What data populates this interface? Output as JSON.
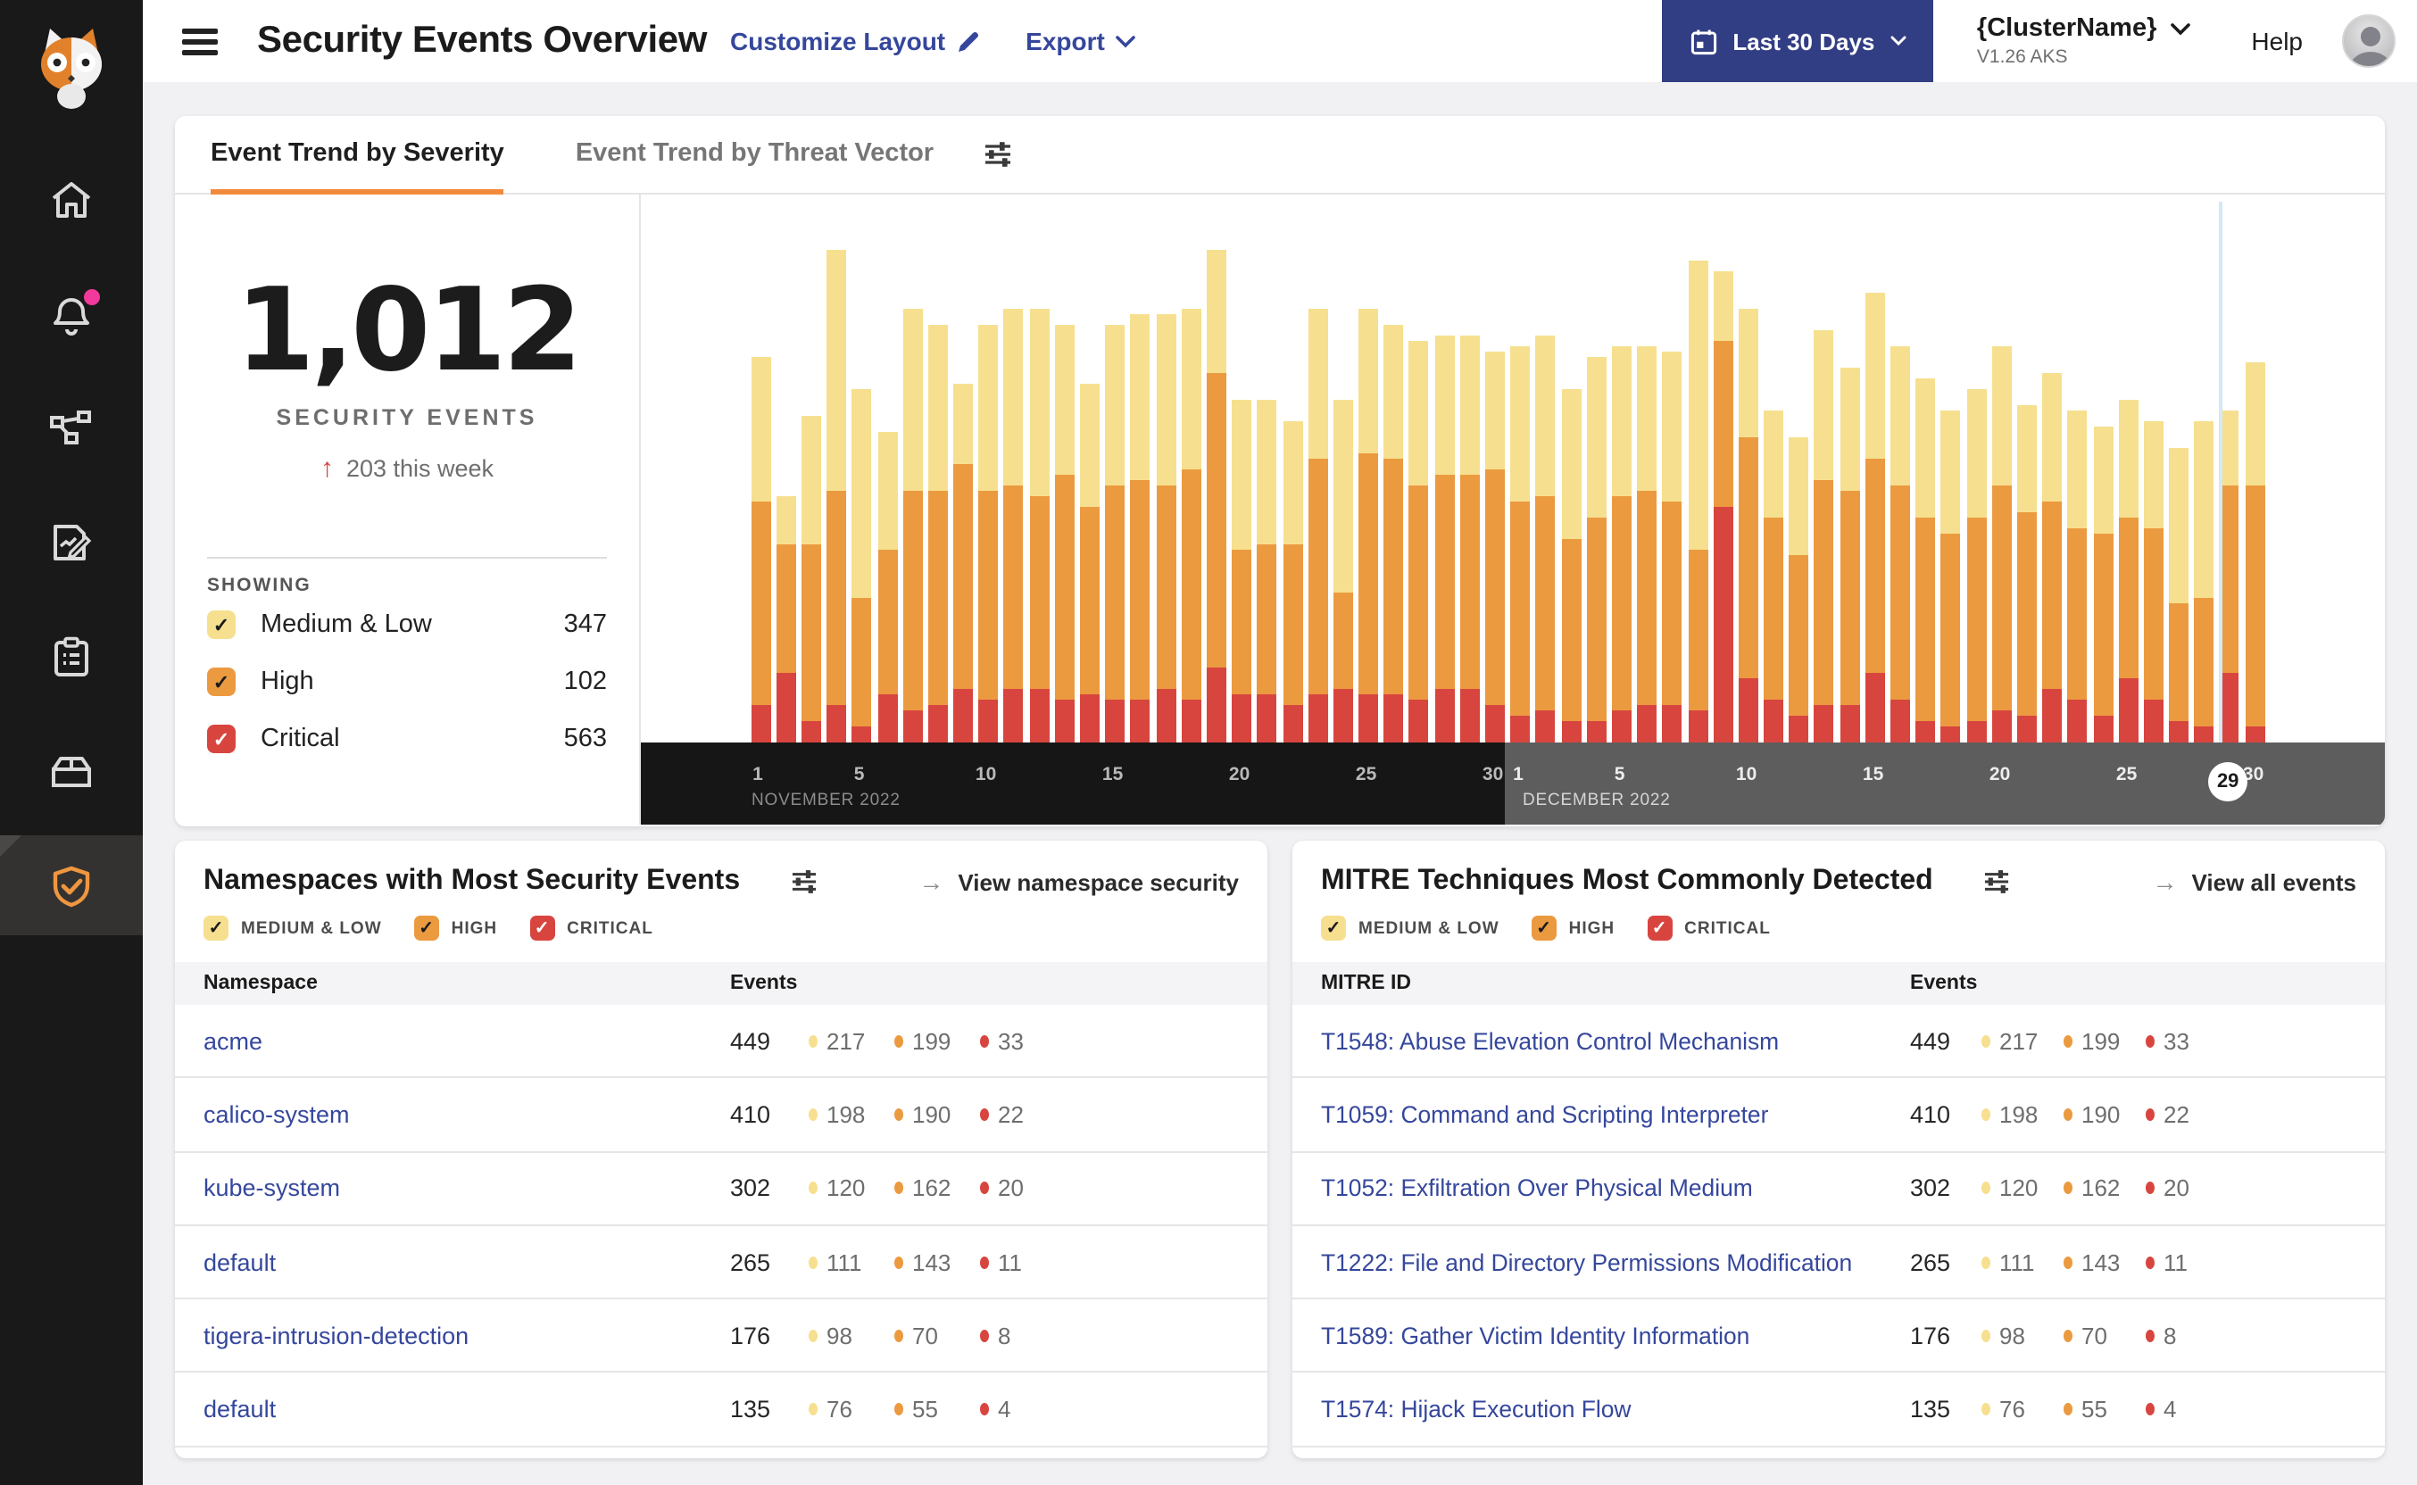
{
  "glyphs": {
    "check": "✓",
    "arrow_right": "→",
    "delta_up": "↑"
  },
  "colors": {
    "medium_low": "#f6e08f",
    "high": "#eb9a40",
    "critical": "#d8453f",
    "link_blue": "#35479c",
    "accent_orange": "#f18a3b",
    "navy": "#323e83",
    "notification_pink": "#f0399b",
    "axis_nov_bg": "#161616",
    "axis_dec_bg": "#5d5d5d",
    "today_line": "#d3e9f4",
    "check_dark": "#1b1b1b",
    "check_white": "#ffffff"
  },
  "sidebar": {
    "items": [
      {
        "icon": "home-icon"
      },
      {
        "icon": "alerts-bell-icon",
        "badge": true
      },
      {
        "icon": "network-graph-icon"
      },
      {
        "icon": "report-edit-icon"
      },
      {
        "icon": "clipboard-icon"
      },
      {
        "icon": "package-icon"
      },
      {
        "icon": "shield-check-icon",
        "active": true
      }
    ]
  },
  "header": {
    "title": "Security Events Overview",
    "customize_label": "Customize Layout",
    "export_label": "Export",
    "date_range_label": "Last 30 Days",
    "cluster_name": "{ClusterName}",
    "cluster_version": "V1.26 AKS",
    "help_label": "Help"
  },
  "trend_card": {
    "tabs": [
      {
        "label": "Event Trend by Severity",
        "active": true
      },
      {
        "label": "Event Trend by Threat Vector",
        "active": false
      }
    ],
    "stats": {
      "total": "1,012",
      "label": "SECURITY EVENTS",
      "delta_text": "203 this week"
    },
    "showing_label": "SHOWING",
    "severities": [
      {
        "label": "Medium & Low",
        "count": "347",
        "color": "#f6e08f",
        "check": "#1b1b1b"
      },
      {
        "label": "High",
        "count": "102",
        "color": "#eb9a40",
        "check": "#1b1b1b"
      },
      {
        "label": "Critical",
        "count": "563",
        "color": "#d8453f",
        "check": "#ffffff"
      }
    ]
  },
  "chart_data": {
    "type": "bar",
    "stacked": true,
    "legend_position": "left-panel",
    "grid": false,
    "unit": "relative bar-segment height, % of plot height (no y-axis shown)",
    "series_colors": {
      "critical": "#d8453f",
      "high": "#eb9a40",
      "medium_low": "#f6e08f"
    },
    "months": [
      {
        "label": "NOVEMBER 2022",
        "ticks": [
          1,
          5,
          10,
          15,
          20,
          25,
          30
        ]
      },
      {
        "label": "DECEMBER 2022",
        "ticks": [
          1,
          5,
          10,
          15,
          20,
          25,
          30
        ]
      }
    ],
    "today": {
      "month_index": 1,
      "day": 29
    },
    "days": [
      {
        "date": "Nov 1",
        "critical": 7,
        "high": 38,
        "medium_low": 27
      },
      {
        "date": "Nov 2",
        "critical": 13,
        "high": 24,
        "medium_low": 9
      },
      {
        "date": "Nov 3",
        "critical": 4,
        "high": 33,
        "medium_low": 24
      },
      {
        "date": "Nov 4",
        "critical": 7,
        "high": 40,
        "medium_low": 45
      },
      {
        "date": "Nov 5",
        "critical": 3,
        "high": 24,
        "medium_low": 39
      },
      {
        "date": "Nov 6",
        "critical": 9,
        "high": 27,
        "medium_low": 22
      },
      {
        "date": "Nov 7",
        "critical": 6,
        "high": 41,
        "medium_low": 34
      },
      {
        "date": "Nov 8",
        "critical": 7,
        "high": 40,
        "medium_low": 31
      },
      {
        "date": "Nov 9",
        "critical": 10,
        "high": 42,
        "medium_low": 15
      },
      {
        "date": "Nov 10",
        "critical": 8,
        "high": 39,
        "medium_low": 31
      },
      {
        "date": "Nov 11",
        "critical": 10,
        "high": 38,
        "medium_low": 33
      },
      {
        "date": "Nov 12",
        "critical": 10,
        "high": 36,
        "medium_low": 35
      },
      {
        "date": "Nov 13",
        "critical": 8,
        "high": 42,
        "medium_low": 28
      },
      {
        "date": "Nov 14",
        "critical": 9,
        "high": 35,
        "medium_low": 23
      },
      {
        "date": "Nov 15",
        "critical": 8,
        "high": 40,
        "medium_low": 30
      },
      {
        "date": "Nov 16",
        "critical": 8,
        "high": 41,
        "medium_low": 31
      },
      {
        "date": "Nov 17",
        "critical": 10,
        "high": 38,
        "medium_low": 32
      },
      {
        "date": "Nov 18",
        "critical": 8,
        "high": 43,
        "medium_low": 30
      },
      {
        "date": "Nov 19",
        "critical": 14,
        "high": 55,
        "medium_low": 23
      },
      {
        "date": "Nov 20",
        "critical": 9,
        "high": 27,
        "medium_low": 28
      },
      {
        "date": "Nov 21",
        "critical": 9,
        "high": 28,
        "medium_low": 27
      },
      {
        "date": "Nov 22",
        "critical": 7,
        "high": 30,
        "medium_low": 23
      },
      {
        "date": "Nov 23",
        "critical": 9,
        "high": 44,
        "medium_low": 28
      },
      {
        "date": "Nov 24",
        "critical": 10,
        "high": 18,
        "medium_low": 36
      },
      {
        "date": "Nov 25",
        "critical": 9,
        "high": 45,
        "medium_low": 27
      },
      {
        "date": "Nov 26",
        "critical": 9,
        "high": 44,
        "medium_low": 25
      },
      {
        "date": "Nov 27",
        "critical": 8,
        "high": 40,
        "medium_low": 27
      },
      {
        "date": "Nov 28",
        "critical": 10,
        "high": 40,
        "medium_low": 26
      },
      {
        "date": "Nov 29",
        "critical": 10,
        "high": 40,
        "medium_low": 26
      },
      {
        "date": "Nov 30",
        "critical": 7,
        "high": 44,
        "medium_low": 22
      },
      {
        "date": "Dec 1",
        "critical": 5,
        "high": 40,
        "medium_low": 29
      },
      {
        "date": "Dec 2",
        "critical": 6,
        "high": 40,
        "medium_low": 30
      },
      {
        "date": "Dec 3",
        "critical": 4,
        "high": 34,
        "medium_low": 28
      },
      {
        "date": "Dec 4",
        "critical": 4,
        "high": 38,
        "medium_low": 30
      },
      {
        "date": "Dec 5",
        "critical": 6,
        "high": 40,
        "medium_low": 28
      },
      {
        "date": "Dec 6",
        "critical": 7,
        "high": 40,
        "medium_low": 27
      },
      {
        "date": "Dec 7",
        "critical": 7,
        "high": 38,
        "medium_low": 28
      },
      {
        "date": "Dec 8",
        "critical": 6,
        "high": 30,
        "medium_low": 54
      },
      {
        "date": "Dec 9",
        "critical": 44,
        "high": 31,
        "medium_low": 13
      },
      {
        "date": "Dec 10",
        "critical": 12,
        "high": 45,
        "medium_low": 24
      },
      {
        "date": "Dec 11",
        "critical": 8,
        "high": 34,
        "medium_low": 20
      },
      {
        "date": "Dec 12",
        "critical": 5,
        "high": 30,
        "medium_low": 22
      },
      {
        "date": "Dec 13",
        "critical": 7,
        "high": 42,
        "medium_low": 28
      },
      {
        "date": "Dec 14",
        "critical": 7,
        "high": 40,
        "medium_low": 23
      },
      {
        "date": "Dec 15",
        "critical": 13,
        "high": 40,
        "medium_low": 31
      },
      {
        "date": "Dec 16",
        "critical": 8,
        "high": 40,
        "medium_low": 26
      },
      {
        "date": "Dec 17",
        "critical": 4,
        "high": 38,
        "medium_low": 26
      },
      {
        "date": "Dec 18",
        "critical": 3,
        "high": 36,
        "medium_low": 23
      },
      {
        "date": "Dec 19",
        "critical": 4,
        "high": 38,
        "medium_low": 24
      },
      {
        "date": "Dec 20",
        "critical": 6,
        "high": 42,
        "medium_low": 26
      },
      {
        "date": "Dec 21",
        "critical": 5,
        "high": 38,
        "medium_low": 20
      },
      {
        "date": "Dec 22",
        "critical": 10,
        "high": 35,
        "medium_low": 24
      },
      {
        "date": "Dec 23",
        "critical": 8,
        "high": 32,
        "medium_low": 22
      },
      {
        "date": "Dec 24",
        "critical": 5,
        "high": 34,
        "medium_low": 20
      },
      {
        "date": "Dec 25",
        "critical": 12,
        "high": 30,
        "medium_low": 22
      },
      {
        "date": "Dec 26",
        "critical": 8,
        "high": 32,
        "medium_low": 20
      },
      {
        "date": "Dec 27",
        "critical": 4,
        "high": 22,
        "medium_low": 29
      },
      {
        "date": "Dec 28",
        "critical": 3,
        "high": 24,
        "medium_low": 33
      },
      {
        "date": "Dec 29",
        "critical": 13,
        "high": 35,
        "medium_low": 14
      },
      {
        "date": "Dec 30",
        "critical": 3,
        "high": 45,
        "medium_low": 23
      }
    ]
  },
  "filters": [
    {
      "label": "MEDIUM & LOW",
      "color": "#f6e08f",
      "check": "#1b1b1b"
    },
    {
      "label": "HIGH",
      "color": "#eb9a40",
      "check": "#1b1b1b"
    },
    {
      "label": "CRITICAL",
      "color": "#d8453f",
      "check": "#ffffff"
    }
  ],
  "namespaces_card": {
    "title": "Namespaces with Most Security Events",
    "link_label": "View namespace security",
    "columns": [
      "Namespace",
      "Events"
    ],
    "rows": [
      {
        "name": "acme",
        "total": "449",
        "medium_low": "217",
        "high": "199",
        "critical": "33"
      },
      {
        "name": "calico-system",
        "total": "410",
        "medium_low": "198",
        "high": "190",
        "critical": "22"
      },
      {
        "name": "kube-system",
        "total": "302",
        "medium_low": "120",
        "high": "162",
        "critical": "20"
      },
      {
        "name": "default",
        "total": "265",
        "medium_low": "111",
        "high": "143",
        "critical": "11"
      },
      {
        "name": "tigera-intrusion-detection",
        "total": "176",
        "medium_low": "98",
        "high": "70",
        "critical": "8"
      },
      {
        "name": "default",
        "total": "135",
        "medium_low": "76",
        "high": "55",
        "critical": "4"
      }
    ]
  },
  "mitre_card": {
    "title": "MITRE Techniques Most Commonly Detected",
    "link_label": "View all events",
    "columns": [
      "MITRE ID",
      "Events"
    ],
    "rows": [
      {
        "name": "T1548: Abuse Elevation Control Mechanism",
        "total": "449",
        "medium_low": "217",
        "high": "199",
        "critical": "33"
      },
      {
        "name": "T1059: Command and Scripting Interpreter",
        "total": "410",
        "medium_low": "198",
        "high": "190",
        "critical": "22"
      },
      {
        "name": "T1052: Exfiltration Over Physical Medium",
        "total": "302",
        "medium_low": "120",
        "high": "162",
        "critical": "20"
      },
      {
        "name": "T1222: File and Directory Permissions Modification",
        "total": "265",
        "medium_low": "111",
        "high": "143",
        "critical": "11"
      },
      {
        "name": "T1589: Gather Victim Identity Information",
        "total": "176",
        "medium_low": "98",
        "high": "70",
        "critical": "8"
      },
      {
        "name": "T1574: Hijack Execution Flow",
        "total": "135",
        "medium_low": "76",
        "high": "55",
        "critical": "4"
      }
    ]
  }
}
